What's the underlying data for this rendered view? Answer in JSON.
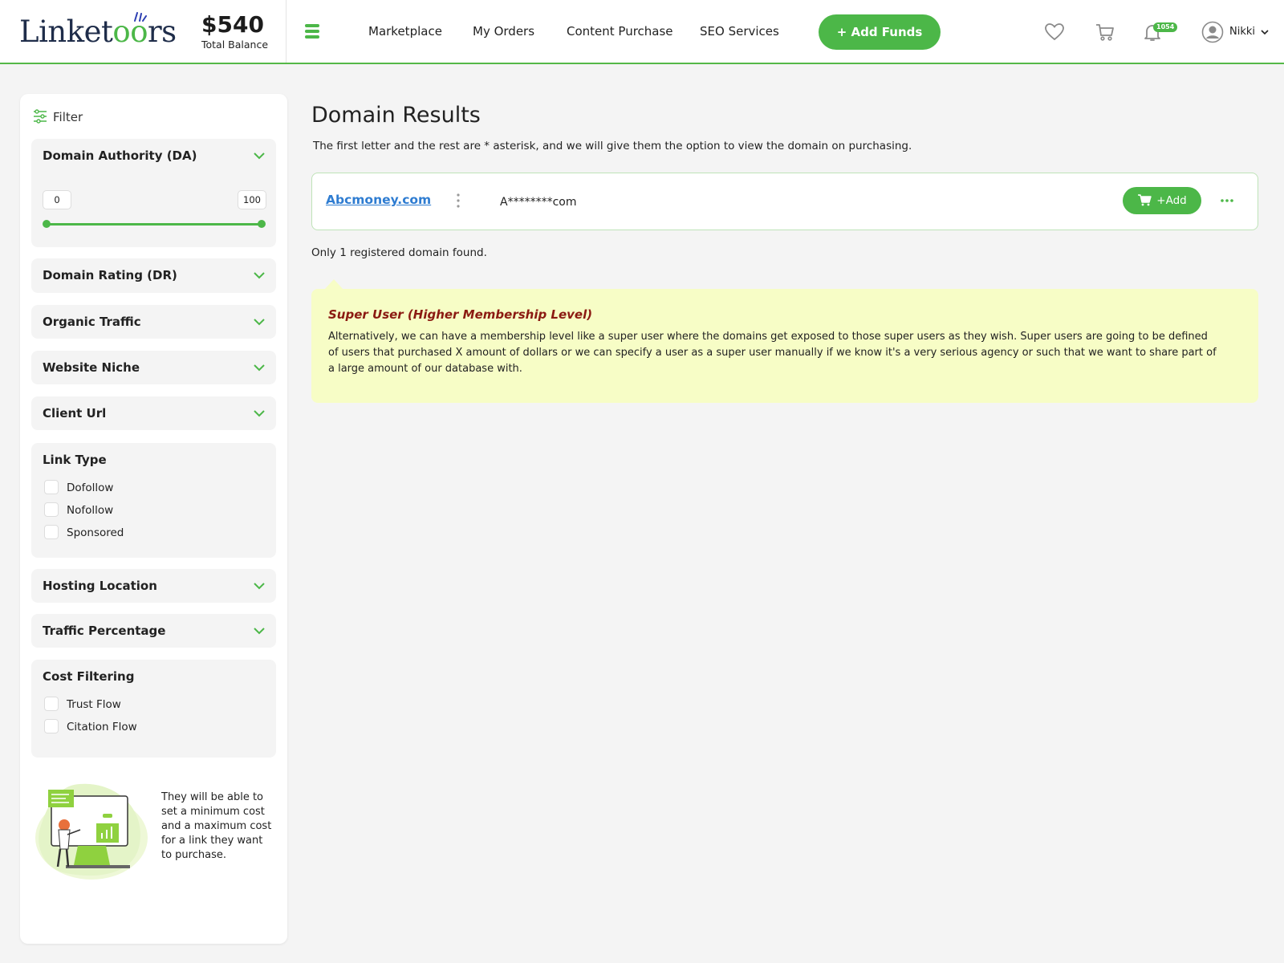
{
  "header": {
    "logo": {
      "part1": "Linket",
      "part2": "oo",
      "part3": "rs"
    },
    "balance": {
      "amount": "$540",
      "label": "Total Balance"
    },
    "nav": [
      "Marketplace",
      "My Orders",
      "Content Purchase",
      "SEO Services"
    ],
    "add_funds_label": "+ Add Funds",
    "notification_count": "1054",
    "user_name": "Nikki",
    "accent_color": "#4cb748"
  },
  "sidebar": {
    "filter_label": "Filter",
    "domain_authority": {
      "title": "Domain Authority (DA)",
      "min": "0",
      "max": "100"
    },
    "collapsed_panels": [
      "Domain Rating (DR)",
      "Organic Traffic",
      "Website Niche",
      "Client Url"
    ],
    "link_type": {
      "title": "Link Type",
      "options": [
        "Dofollow",
        "Nofollow",
        "Sponsored"
      ]
    },
    "collapsed_panels_2": [
      "Hosting Location",
      "Traffic Percentage"
    ],
    "cost_filtering": {
      "title": "Cost Filtering",
      "options": [
        "Trust Flow",
        "Citation Flow"
      ]
    },
    "promo_text": "They will be able to set a minimum cost and a maximum cost for a link they want to purchase."
  },
  "main": {
    "title": "Domain Results",
    "subtitle": "The first letter and the rest are * asterisk, and we will give them the option to view the domain on purchasing.",
    "result": {
      "domain": "Abcmoney.com",
      "masked": "A********com",
      "add_label": "+Add"
    },
    "found_text": "Only 1 registered domain found.",
    "note": {
      "title": "Super User (Higher Membership Level)",
      "body": "Alternatively, we can have a membership level like a super user where the domains get exposed to those super users as they wish. Super users are going to be defined of users that purchased X amount of dollars or we can specify a user as a super user manually if we know it's a very serious agency or such that we want to share part of a large amount of our database with."
    }
  }
}
